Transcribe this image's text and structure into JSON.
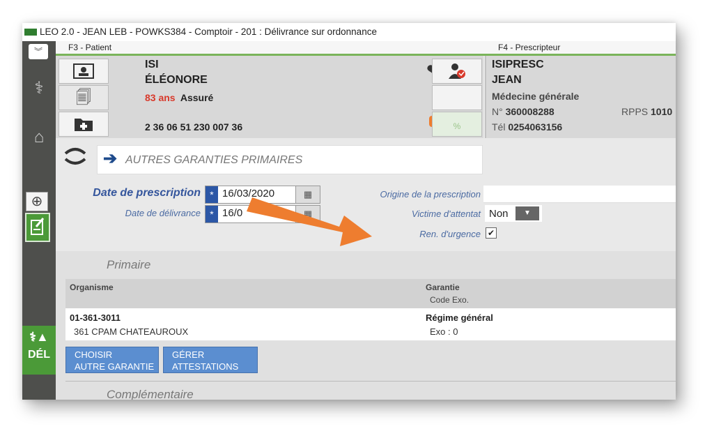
{
  "window": {
    "title": "LEO 2.0 - JEAN LEB - POWKS384 - Comptoir - 201 : Délivrance sur ordonnance"
  },
  "tabs": {
    "patient": "F3 - Patient",
    "prescripteur": "F4 - Prescripteur"
  },
  "patient": {
    "last_name": "ISI",
    "first_name": "ÉLÉONORE",
    "age": "83 ans",
    "status": "Assuré",
    "ssn": "2 36 06 51 230 007 36"
  },
  "prescriber": {
    "last_name": "ISIPRESC",
    "first_name": "JEAN",
    "specialty": "Médecine générale",
    "num_prefix": "N°",
    "num": "360008288",
    "rpps_label": "RPPS",
    "rpps": "1010",
    "tel_prefix": "Tél",
    "tel": "0254063156"
  },
  "garanties": {
    "header": "AUTRES GARANTIES PRIMAIRES"
  },
  "form": {
    "date_prescription_label": "Date de prescription",
    "date_prescription": "16/03/2020",
    "date_delivrance_label": "Date de délivrance",
    "date_delivrance": "16/0",
    "origine_label": "Origine de la prescription",
    "victime_label": "Victime d'attentat",
    "victime_value": "Non",
    "urgence_label": "Ren. d'urgence"
  },
  "primaire": {
    "title": "Primaire",
    "col_organisme": "Organisme",
    "col_garantie": "Garantie",
    "col_code_exo": "Code Exo.",
    "rows": [
      {
        "organisme_code": "01-361-3011",
        "organisme_name": "361 CPAM CHATEAUROUX",
        "garantie": "Régime général",
        "exo": "Exo : 0"
      }
    ],
    "btn_choisir_line1": "CHOISIR",
    "btn_choisir_line2": "AUTRE GARANTIE",
    "btn_gerer_line1": "GÉRER",
    "btn_gerer_line2": "ATTESTATIONS"
  },
  "complementaire": {
    "title": "Complémentaire"
  },
  "sidebar": {
    "del_label": "DÉL"
  },
  "colors": {
    "accent_green": "#4b9a38",
    "brand_blue": "#2c57a6",
    "arrow_orange": "#ee7d2f"
  }
}
